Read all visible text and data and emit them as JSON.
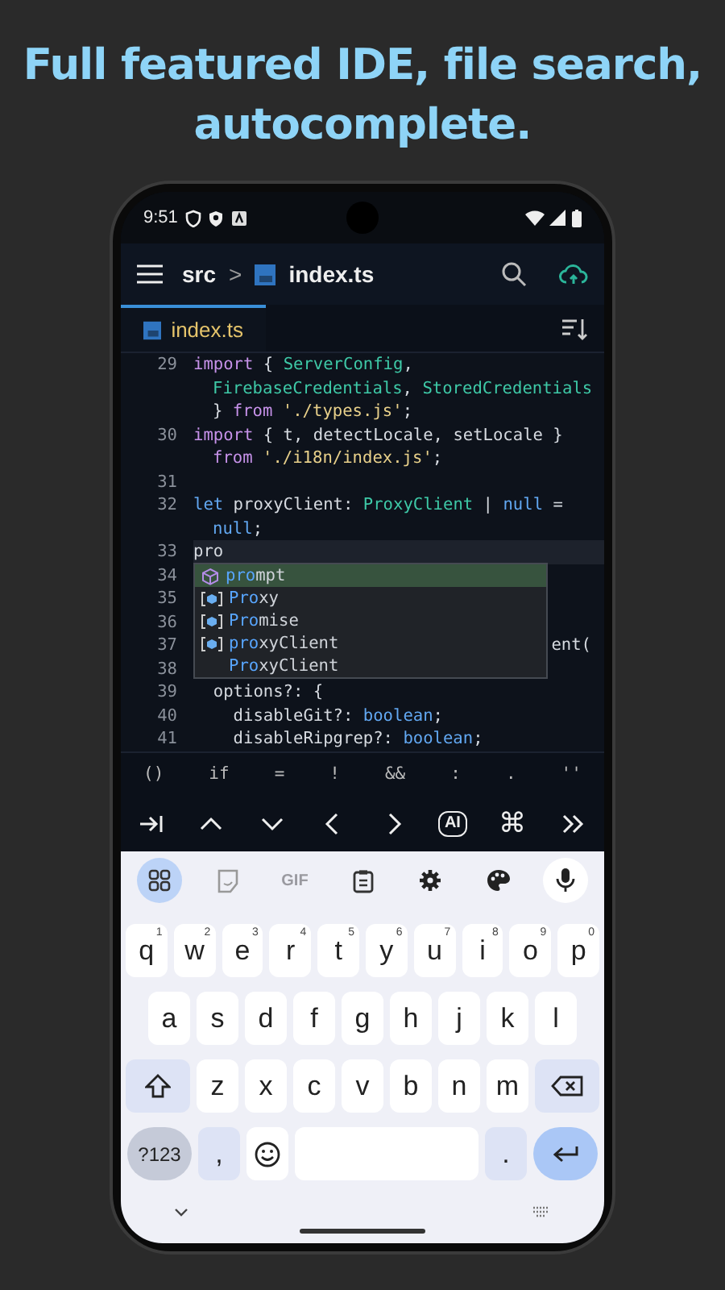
{
  "headline": "Full featured IDE, file search, autocomplete.",
  "status_bar": {
    "time": "9:51"
  },
  "app_bar": {
    "folder": "src",
    "separator": ">",
    "file": "index.ts"
  },
  "tabs": [
    {
      "label": "index.ts",
      "selected": true
    }
  ],
  "editor": {
    "lines": [
      {
        "number": "29",
        "current": false,
        "rows": [
          {
            "tokens": [
              {
                "text": "import",
                "kind": "keyword"
              },
              {
                "text": " { ",
                "kind": "plain"
              },
              {
                "text": "ServerConfig",
                "kind": "type"
              },
              {
                "text": ",",
                "kind": "plain"
              }
            ]
          },
          {
            "tokens": [
              {
                "text": "FirebaseCredentials",
                "kind": "type"
              },
              {
                "text": ", ",
                "kind": "plain"
              },
              {
                "text": "StoredCredentials",
                "kind": "type"
              }
            ]
          },
          {
            "tokens": [
              {
                "text": "} ",
                "kind": "plain"
              },
              {
                "text": "from ",
                "kind": "keyword"
              },
              {
                "text": "'./types.js'",
                "kind": "string"
              },
              {
                "text": ";",
                "kind": "plain"
              }
            ]
          }
        ]
      },
      {
        "number": "30",
        "current": false,
        "rows": [
          {
            "tokens": [
              {
                "text": "import",
                "kind": "keyword"
              },
              {
                "text": " { t, detectLocale, setLocale }",
                "kind": "plain"
              }
            ]
          },
          {
            "tokens": [
              {
                "text": "from ",
                "kind": "keyword"
              },
              {
                "text": "'./i18n/index.js'",
                "kind": "string"
              },
              {
                "text": ";",
                "kind": "plain"
              }
            ]
          }
        ]
      },
      {
        "number": "31",
        "current": false,
        "rows": [
          {
            "tokens": []
          }
        ]
      },
      {
        "number": "32",
        "current": false,
        "rows": [
          {
            "tokens": [
              {
                "text": "let",
                "kind": "builtin"
              },
              {
                "text": " proxyClient: ",
                "kind": "plain"
              },
              {
                "text": "ProxyClient",
                "kind": "type"
              },
              {
                "text": " | ",
                "kind": "plain"
              },
              {
                "text": "null",
                "kind": "builtin"
              },
              {
                "text": " =",
                "kind": "plain"
              }
            ]
          },
          {
            "tokens": [
              {
                "text": "null",
                "kind": "builtin"
              },
              {
                "text": ";",
                "kind": "plain"
              }
            ]
          }
        ]
      },
      {
        "number": "33",
        "current": true,
        "rows": [
          {
            "tokens": [
              {
                "text": "pro",
                "kind": "plain"
              }
            ]
          }
        ]
      },
      {
        "number": "34",
        "current": false,
        "rows": [
          {
            "tokens": []
          }
        ]
      },
      {
        "number": "35",
        "current": false,
        "rows": [
          {
            "tokens": []
          }
        ]
      },
      {
        "number": "36",
        "current": false,
        "rows": [
          {
            "tokens": []
          }
        ]
      },
      {
        "number": "37",
        "current": false,
        "covered": true,
        "rows": [
          {
            "tokens": [
              {
                "text": "ent(",
                "kind": "plain"
              }
            ]
          }
        ]
      },
      {
        "number": "38",
        "current": false,
        "rows": [
          {
            "tokens": []
          }
        ]
      },
      {
        "number": "39",
        "current": false,
        "rows": [
          {
            "tokens": [
              {
                "text": "  options?: {",
                "kind": "plain"
              }
            ]
          }
        ]
      },
      {
        "number": "40",
        "current": false,
        "rows": [
          {
            "tokens": [
              {
                "text": "    disableGit?: ",
                "kind": "plain"
              },
              {
                "text": "boolean",
                "kind": "builtin"
              },
              {
                "text": ";",
                "kind": "plain"
              }
            ]
          }
        ]
      },
      {
        "number": "41",
        "current": false,
        "rows": [
          {
            "tokens": [
              {
                "text": "    disableRipgrep?: ",
                "kind": "plain"
              },
              {
                "text": "boolean",
                "kind": "builtin"
              },
              {
                "text": ";",
                "kind": "plain"
              }
            ]
          }
        ]
      }
    ]
  },
  "autocomplete": {
    "items": [
      {
        "kind": "module",
        "match": "pro",
        "rest": "mpt",
        "selected": true
      },
      {
        "kind": "variable",
        "match": "Pro",
        "rest": "xy",
        "selected": false
      },
      {
        "kind": "variable",
        "match": "Pro",
        "rest": "mise",
        "selected": false
      },
      {
        "kind": "variable",
        "match": "pro",
        "rest": "xyClient",
        "selected": false
      },
      {
        "kind": "none",
        "match": "Pro",
        "rest": "xyClient",
        "selected": false
      }
    ]
  },
  "symbol_bar": [
    "()",
    "if",
    "=",
    "!",
    "&&",
    ":",
    ".",
    "''"
  ],
  "nav_bar": [
    {
      "kind": "tab"
    },
    {
      "kind": "up"
    },
    {
      "kind": "down"
    },
    {
      "kind": "left"
    },
    {
      "kind": "right"
    },
    {
      "kind": "ai",
      "label": "AI"
    },
    {
      "kind": "command",
      "label": "⌘"
    },
    {
      "kind": "more"
    }
  ],
  "keyboard": {
    "tools": [
      {
        "kind": "apps",
        "selected": true
      },
      {
        "kind": "sticker",
        "selected": false
      },
      {
        "kind": "gif",
        "label": "GIF",
        "selected": false
      },
      {
        "kind": "clipboard",
        "selected": false
      },
      {
        "kind": "settings",
        "selected": false
      },
      {
        "kind": "palette",
        "selected": false
      },
      {
        "kind": "mic",
        "selected": false
      }
    ],
    "rows": [
      {
        "keys": [
          {
            "label": "q",
            "hint": "1"
          },
          {
            "label": "w",
            "hint": "2"
          },
          {
            "label": "e",
            "hint": "3"
          },
          {
            "label": "r",
            "hint": "4"
          },
          {
            "label": "t",
            "hint": "5"
          },
          {
            "label": "y",
            "hint": "6"
          },
          {
            "label": "u",
            "hint": "7"
          },
          {
            "label": "i",
            "hint": "8"
          },
          {
            "label": "o",
            "hint": "9"
          },
          {
            "label": "p",
            "hint": "0"
          }
        ]
      },
      {
        "keys": [
          {
            "label": "a"
          },
          {
            "label": "s"
          },
          {
            "label": "d"
          },
          {
            "label": "f"
          },
          {
            "label": "g"
          },
          {
            "label": "h"
          },
          {
            "label": "j"
          },
          {
            "label": "k"
          },
          {
            "label": "l"
          }
        ]
      },
      {
        "keys": [
          {
            "kind": "shift"
          },
          {
            "label": "z"
          },
          {
            "label": "x"
          },
          {
            "label": "c"
          },
          {
            "label": "v"
          },
          {
            "label": "b"
          },
          {
            "label": "n"
          },
          {
            "label": "m"
          },
          {
            "kind": "backspace"
          }
        ]
      },
      {
        "keys": [
          {
            "kind": "numbers",
            "label": "?123"
          },
          {
            "kind": "punct",
            "label": ","
          },
          {
            "kind": "emoji"
          },
          {
            "kind": "space"
          },
          {
            "kind": "punct",
            "label": "."
          },
          {
            "kind": "enter"
          }
        ]
      }
    ]
  }
}
